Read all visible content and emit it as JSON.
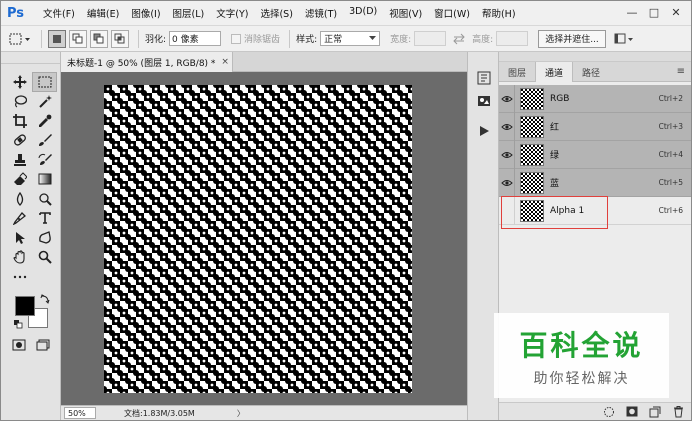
{
  "app": {
    "logo": "Ps"
  },
  "menu": [
    "文件(F)",
    "编辑(E)",
    "图像(I)",
    "图层(L)",
    "文字(Y)",
    "选择(S)",
    "滤镜(T)",
    "3D(D)",
    "视图(V)",
    "窗口(W)",
    "帮助(H)"
  ],
  "window_controls": [
    "—",
    "□",
    "✕"
  ],
  "options": {
    "feather_label": "羽化:",
    "feather_value": "0 像素",
    "antialias_label": "消除锯齿",
    "style_label": "样式:",
    "style_value": "正常",
    "width_label": "宽度:",
    "height_label": "高度:",
    "refine_button": "选择并遮住..."
  },
  "document": {
    "tab_title": "未标题-1 @ 50% (图层 1, RGB/8) *",
    "tab_close": "×",
    "zoom": "50%",
    "doc_info": "文档:1.83M/3.05M",
    "status_arrow": "〉"
  },
  "panel": {
    "tabs": [
      "图层",
      "通道",
      "路径"
    ],
    "active_tab": 1,
    "menu_icon": "≡",
    "channels": [
      {
        "name": "RGB",
        "shortcut": "Ctrl+2",
        "visible": true
      },
      {
        "name": "红",
        "shortcut": "Ctrl+3",
        "visible": true
      },
      {
        "name": "绿",
        "shortcut": "Ctrl+4",
        "visible": true
      },
      {
        "name": "蓝",
        "shortcut": "Ctrl+5",
        "visible": true
      },
      {
        "name": "Alpha 1",
        "shortcut": "Ctrl+6",
        "visible": false
      }
    ]
  },
  "watermark": {
    "title": "百科全说",
    "subtitle": "助你轻松解决"
  },
  "colors": {
    "foreground": "#000000",
    "background": "#ffffff",
    "highlight": "#e0403c",
    "watermark_green": "#23a334"
  }
}
